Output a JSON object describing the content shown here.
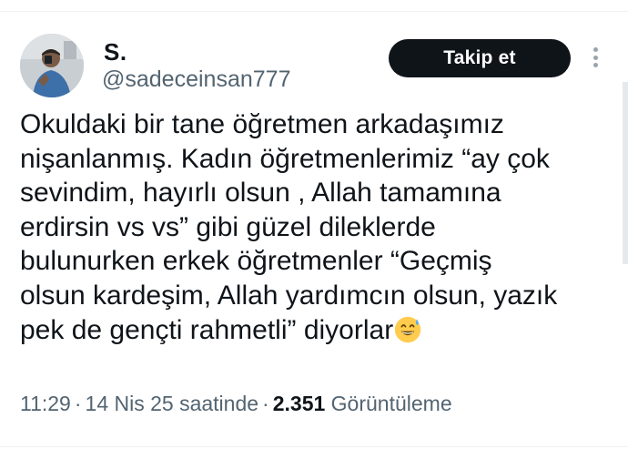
{
  "author": {
    "display_name": "S.",
    "handle": "@sadeceinsan777"
  },
  "actions": {
    "follow_label": "Takip et",
    "more_icon": "vertical-ellipsis-icon"
  },
  "tweet": {
    "lines": [
      "Okuldaki bir tane öğretmen arkadaşımız",
      "nişanlanmış. Kadın öğretmenlerimiz “ay çok",
      "sevindim, hayırlı olsun , Allah tamamına",
      "erdirsin vs vs” gibi güzel dileklerde",
      "bulunurken erkek öğretmenler “Geçmiş",
      "olsun kardeşim, Allah yardımcın olsun, yazık",
      "pek de gençti rahmetli” diyorlar"
    ],
    "emoji": "grinning-face-with-sweat"
  },
  "meta": {
    "time": "11:29",
    "date": "14 Nis 25 saatinde",
    "views_count": "2.351",
    "views_label": "Görüntüleme",
    "separator": "·"
  },
  "colors": {
    "text_primary": "#0f1419",
    "text_secondary": "#536471",
    "follow_bg": "#0f1419",
    "follow_text": "#ffffff"
  }
}
